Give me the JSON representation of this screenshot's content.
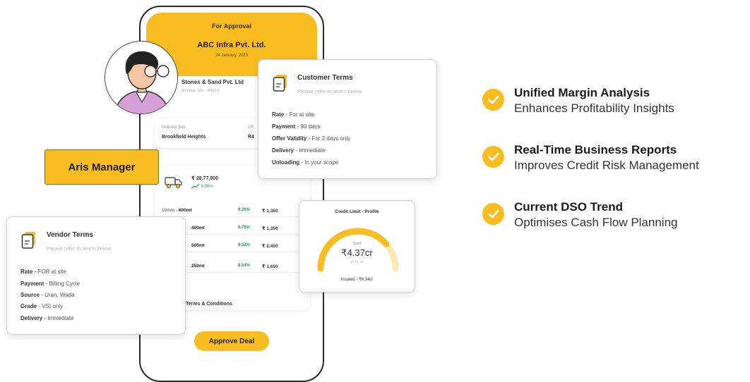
{
  "phone": {
    "status": "For Approval",
    "company": "ABC Infra Pvt. Ltd.",
    "date": "24 January, 2023",
    "vendor_name": "Stones & Sand Pvt. Ltd",
    "vendor_address": "Mumbai, MH - 400001",
    "delivery_site_label": "Delivery Site",
    "delivery_site_value": "Brookfield Heights",
    "offer_label": "Off",
    "offer_value": "R4",
    "total_amount": "₹ 28,77,500",
    "trend": "9.06%",
    "rows": [
      {
        "qty_prefix": "10mm - ",
        "qty": "600mt",
        "pct": "9.26%",
        "price": "₹ 1,350"
      },
      {
        "qty_prefix": "",
        "qty": "400mt",
        "pct": "8.76%",
        "price": "₹ 1,350"
      },
      {
        "qty_prefix": "",
        "qty": "500mt",
        "pct": "9.32%",
        "price": "₹ 2,450"
      },
      {
        "qty_prefix": "",
        "qty": "250mt",
        "pct": "8.54%",
        "price": "₹ 1,650"
      }
    ],
    "terms_label": "Terms & Conditions",
    "approve_label": "Approve Deal"
  },
  "tag": {
    "label": "Aris Manager"
  },
  "customer_terms": {
    "title": "Customer Terms",
    "subtitle": "Please refer to terms below",
    "lines": [
      {
        "key": "Rate",
        "value": "For at site"
      },
      {
        "key": "Payment",
        "value": "90 days"
      },
      {
        "key": "Offer Validity",
        "value": "For 2 days only"
      },
      {
        "key": "Delivery",
        "value": "Immediate"
      },
      {
        "key": "Unloading",
        "value": "In your scope"
      }
    ]
  },
  "vendor_terms": {
    "title": "Vendor Terms",
    "subtitle": "Please refer to terms below",
    "lines": [
      {
        "key": "Rate",
        "value": "FOR at site"
      },
      {
        "key": "Payment",
        "value": "Billing Cycle"
      },
      {
        "key": "Source",
        "value": "Uran, Wada"
      },
      {
        "key": "Grade",
        "value": "VSI only"
      },
      {
        "key": "Delivery",
        "value": "Immediate"
      }
    ]
  },
  "credit": {
    "title": "Credit Limit - Profile",
    "used_label": "Used",
    "amount": "₹4.37cr",
    "of_label": "Of ₹5.7cr",
    "insured": "Insured - ₹6.34cr",
    "used_fraction": 0.77
  },
  "features": [
    {
      "title": "Unified Margin Analysis",
      "subtitle": "Enhances Profitability Insights"
    },
    {
      "title": "Real-Time Business Reports",
      "subtitle": "Improves Credit Risk Management"
    },
    {
      "title": "Current DSO Trend",
      "subtitle": "Optimises Cash Flow Planning"
    }
  ],
  "colors": {
    "accent": "#f9bd22",
    "positive": "#22a055"
  },
  "icons": [
    "doc-icon",
    "truck-icon",
    "check-icon",
    "trend-up-icon"
  ]
}
